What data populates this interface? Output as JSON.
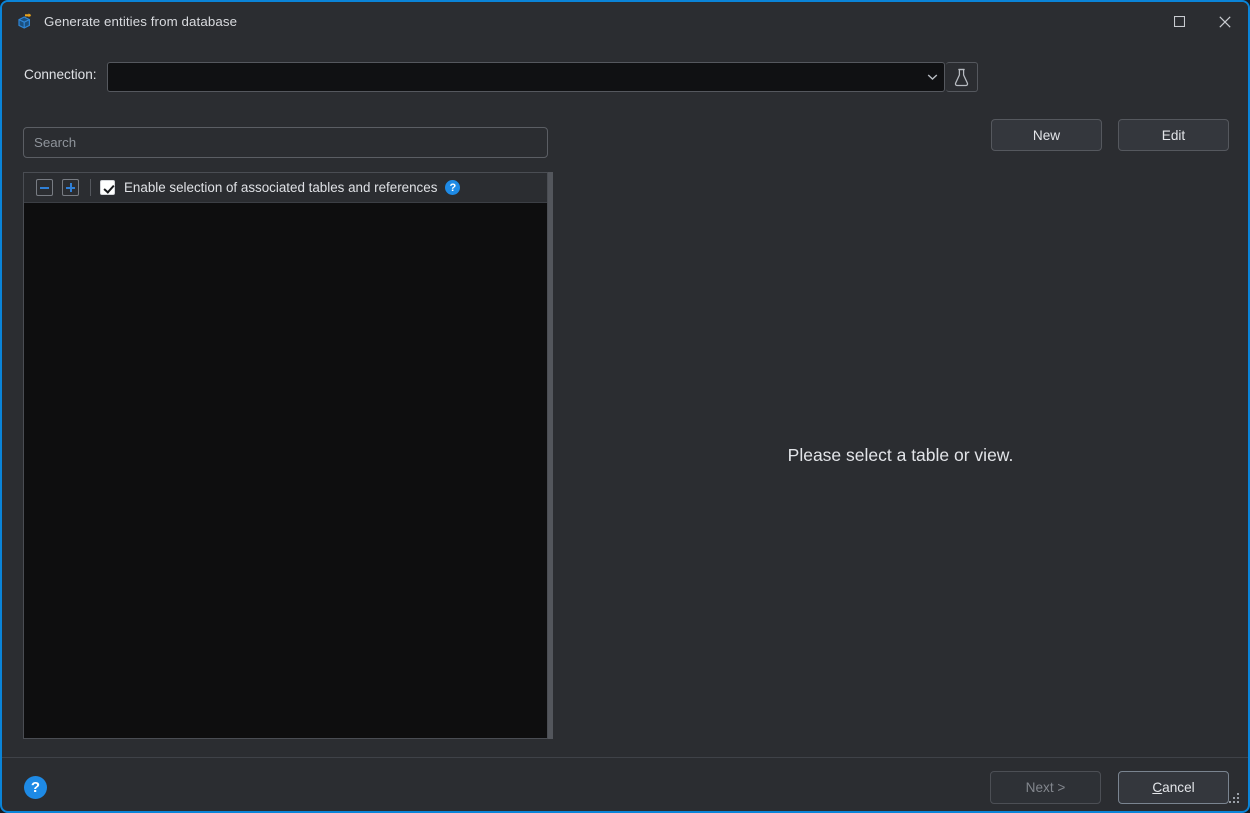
{
  "window": {
    "title": "Generate entities from database",
    "icon": "database-entities-icon",
    "maximize_label": "▢",
    "close_label": "✕",
    "accent_color": "#0a84d8",
    "background_color": "#2b2d31"
  },
  "connection": {
    "label": "Connection:",
    "value": "",
    "placeholder": "",
    "dropdown_icon": "chevron-down-icon",
    "test_icon": "flask-icon",
    "new_button": "New",
    "edit_button": "Edit"
  },
  "search": {
    "value": "",
    "placeholder": "Search"
  },
  "tree": {
    "collapse_all_icon": "collapse-all-icon",
    "expand_all_icon": "expand-all-icon",
    "associated_checkbox": {
      "checked": true,
      "label": "Enable selection of associated tables and references",
      "help_icon": "help-icon",
      "help_glyph": "?"
    },
    "items": []
  },
  "detail": {
    "message": "Please select a table or view."
  },
  "footer": {
    "help_glyph": "?",
    "help_icon": "help-icon",
    "next_button": "Next >",
    "next_enabled": false,
    "cancel_button_prefix": "",
    "cancel_button_mnemonic": "C",
    "cancel_button_suffix": "ancel",
    "resize_grip": "resize-grip"
  }
}
